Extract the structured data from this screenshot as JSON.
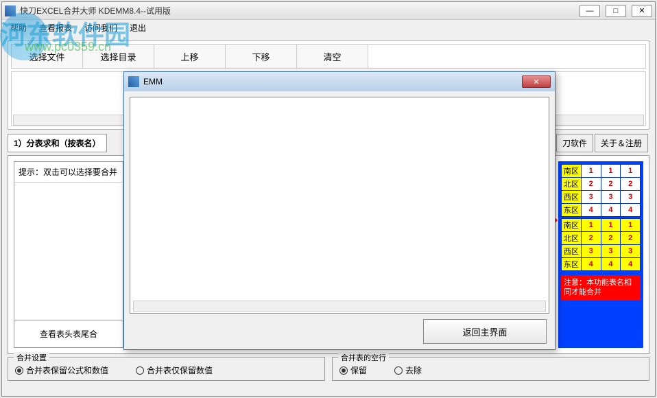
{
  "window": {
    "title": "快刀EXCEL合并大师 KDEMM8.4--试用版"
  },
  "menu": {
    "items": [
      "帮助",
      "查看报表",
      "访问我们",
      "退出"
    ]
  },
  "watermark": {
    "text": "河东软件园",
    "url": "www.pc0359.cn"
  },
  "toolbar": {
    "select_file": "选择文件",
    "select_dir": "选择目录",
    "move_up": "上移",
    "move_down": "下移",
    "clear": "清空"
  },
  "tabs": {
    "first": "1）分表求和（按表名）",
    "software": "刀软件",
    "about": "关于＆注册"
  },
  "hint": "提示：双击可以选择要合并",
  "view_header_btn": "查看表头表尾合",
  "example_table": {
    "rows1": [
      [
        "南区",
        "1",
        "1",
        "1"
      ],
      [
        "北区",
        "2",
        "2",
        "2"
      ],
      [
        "西区",
        "3",
        "3",
        "3"
      ],
      [
        "东区",
        "4",
        "4",
        "4"
      ]
    ],
    "rows2": [
      [
        "南区",
        "1",
        "1",
        "1"
      ],
      [
        "北区",
        "2",
        "2",
        "2"
      ],
      [
        "西区",
        "3",
        "3",
        "3"
      ],
      [
        "东区",
        "4",
        "4",
        "4"
      ]
    ]
  },
  "notice": "注意：本功能表名相同才能合并",
  "settings": {
    "merge_title": "合并设置",
    "opt_formula": "合并表保留公式和数值",
    "opt_value": "合并表仅保留数值",
    "blank_title": "合并表的空行",
    "opt_keep": "保留",
    "opt_remove": "去除"
  },
  "modal": {
    "title": "EMM",
    "back_btn": "返回主界面"
  }
}
